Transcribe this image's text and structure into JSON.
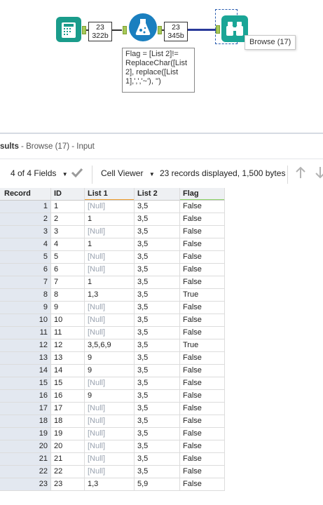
{
  "canvas": {
    "input_conn": {
      "records": "23",
      "bytes": "322b"
    },
    "output_conn": {
      "records": "23",
      "bytes": "345b"
    },
    "formula_annotation": "Flag = [List 2]!= ReplaceChar([List 2], replace([List 1],',','~'), '')",
    "browse_tooltip": "Browse (17)",
    "colors": {
      "input_tool": "#1a9c8b",
      "formula_tool": "#1a7fbf",
      "browse_tool": "#1aa596",
      "anchor": "#a7c957"
    }
  },
  "results": {
    "header_bold": "sults",
    "header_rest": " - Browse (17) - Input",
    "fields_dropdown": "4 of 4 Fields",
    "viewer_dropdown": "Cell Viewer",
    "summary": "23 records displayed, 1,500 bytes"
  },
  "grid": {
    "columns": [
      "Record",
      "ID",
      "List 1",
      "List 2",
      "Flag"
    ],
    "rows": [
      {
        "record": "1",
        "id": "1",
        "list1": "[Null]",
        "list2": "3,5",
        "flag": "False"
      },
      {
        "record": "2",
        "id": "2",
        "list1": "1",
        "list2": "3,5",
        "flag": "False"
      },
      {
        "record": "3",
        "id": "3",
        "list1": "[Null]",
        "list2": "3,5",
        "flag": "False"
      },
      {
        "record": "4",
        "id": "4",
        "list1": "1",
        "list2": "3,5",
        "flag": "False"
      },
      {
        "record": "5",
        "id": "5",
        "list1": "[Null]",
        "list2": "3,5",
        "flag": "False"
      },
      {
        "record": "6",
        "id": "6",
        "list1": "[Null]",
        "list2": "3,5",
        "flag": "False"
      },
      {
        "record": "7",
        "id": "7",
        "list1": "1",
        "list2": "3,5",
        "flag": "False"
      },
      {
        "record": "8",
        "id": "8",
        "list1": "1,3",
        "list2": "3,5",
        "flag": "True"
      },
      {
        "record": "9",
        "id": "9",
        "list1": "[Null]",
        "list2": "3,5",
        "flag": "False"
      },
      {
        "record": "10",
        "id": "10",
        "list1": "[Null]",
        "list2": "3,5",
        "flag": "False"
      },
      {
        "record": "11",
        "id": "11",
        "list1": "[Null]",
        "list2": "3,5",
        "flag": "False"
      },
      {
        "record": "12",
        "id": "12",
        "list1": "3,5,6,9",
        "list2": "3,5",
        "flag": "True"
      },
      {
        "record": "13",
        "id": "13",
        "list1": "9",
        "list2": "3,5",
        "flag": "False"
      },
      {
        "record": "14",
        "id": "14",
        "list1": "9",
        "list2": "3,5",
        "flag": "False"
      },
      {
        "record": "15",
        "id": "15",
        "list1": "[Null]",
        "list2": "3,5",
        "flag": "False"
      },
      {
        "record": "16",
        "id": "16",
        "list1": "9",
        "list2": "3,5",
        "flag": "False"
      },
      {
        "record": "17",
        "id": "17",
        "list1": "[Null]",
        "list2": "3,5",
        "flag": "False"
      },
      {
        "record": "18",
        "id": "18",
        "list1": "[Null]",
        "list2": "3,5",
        "flag": "False"
      },
      {
        "record": "19",
        "id": "19",
        "list1": "[Null]",
        "list2": "3,5",
        "flag": "False"
      },
      {
        "record": "20",
        "id": "20",
        "list1": "[Null]",
        "list2": "3,5",
        "flag": "False"
      },
      {
        "record": "21",
        "id": "21",
        "list1": "[Null]",
        "list2": "3,5",
        "flag": "False"
      },
      {
        "record": "22",
        "id": "22",
        "list1": "[Null]",
        "list2": "3,5",
        "flag": "False"
      },
      {
        "record": "23",
        "id": "23",
        "list1": "1,3",
        "list2": "5,9",
        "flag": "False"
      }
    ]
  }
}
